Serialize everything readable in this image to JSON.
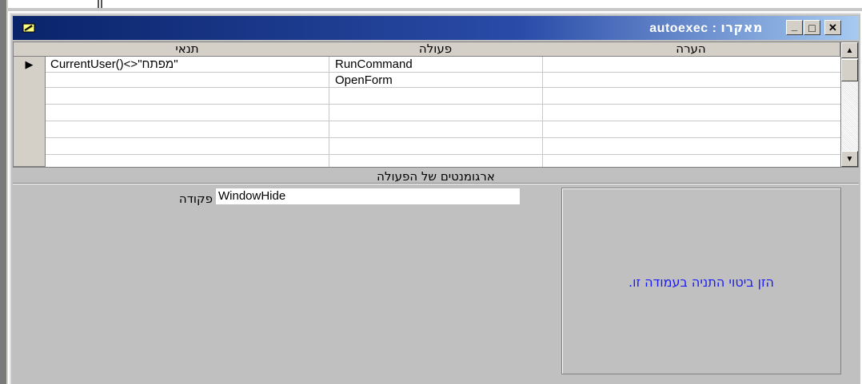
{
  "window": {
    "title_name": "autoexec",
    "title_sep": " : ",
    "title_type": "מאקרו",
    "buttons": {
      "minimize": "_",
      "maximize": "□",
      "close": "✕"
    }
  },
  "grid": {
    "headers": {
      "condition": "תנאי",
      "action": "פעולה",
      "comment": "הערה"
    },
    "rows": [
      {
        "condition": "CurrentUser()<>\"מפתח\"",
        "action": "RunCommand",
        "comment": ""
      },
      {
        "condition": "",
        "action": "OpenForm",
        "comment": ""
      },
      {
        "condition": "",
        "action": "",
        "comment": ""
      },
      {
        "condition": "",
        "action": "",
        "comment": ""
      },
      {
        "condition": "",
        "action": "",
        "comment": ""
      },
      {
        "condition": "",
        "action": "",
        "comment": ""
      }
    ],
    "current_row_marker": "▶",
    "scroll_up": "▲",
    "scroll_down": "▼"
  },
  "arguments": {
    "section_title": "ארגומנטים של הפעולה",
    "command_label": "פקודה",
    "command_value": "WindowHide"
  },
  "help": {
    "text": "הזן ביטוי התניה בעמודה זו."
  },
  "colors": {
    "title_start": "#0a246a",
    "title_end": "#a6caf0",
    "face": "#c0c0c0",
    "help_text": "#1a1aff"
  }
}
